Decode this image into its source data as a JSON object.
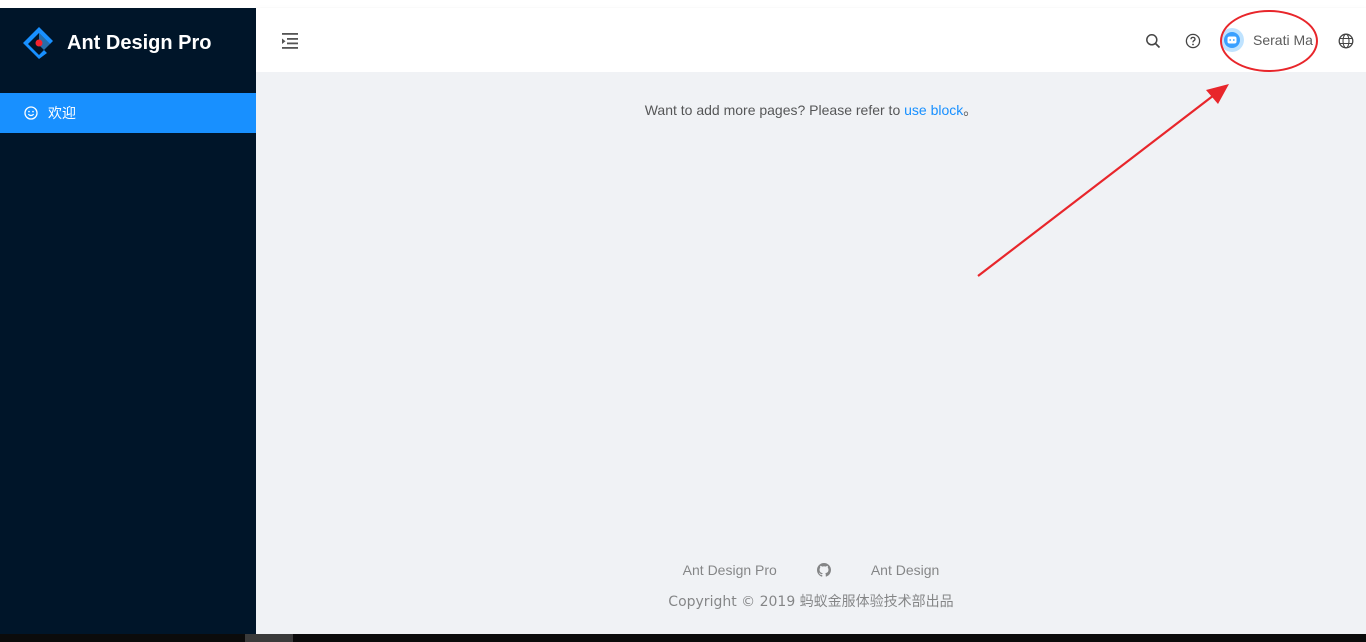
{
  "app": {
    "title": "Ant Design Pro",
    "logo_icon": "ant-design-logo-icon"
  },
  "sidebar": {
    "items": [
      {
        "label": "欢迎",
        "icon": "smile-icon",
        "active": true
      }
    ]
  },
  "header": {
    "icons": [
      "menu-fold-icon",
      "search-icon",
      "question-circle-icon",
      "globe-icon"
    ],
    "user": {
      "name": "Serati Ma",
      "avatar_icon": "avatar-icon"
    }
  },
  "main": {
    "tip_text": "Want to add more pages? Please refer to ",
    "tip_link": "use block",
    "tip_suffix": "。"
  },
  "footer": {
    "links": [
      "Ant Design Pro",
      "Ant Design"
    ],
    "github_icon": "github-icon",
    "copyright": "Copyright © 2019 蚂蚁金服体验技术部出品"
  },
  "colors": {
    "sider_bg": "#001529",
    "primary": "#1890ff",
    "content_bg": "#f0f2f5",
    "annotation": "#e8262b"
  }
}
